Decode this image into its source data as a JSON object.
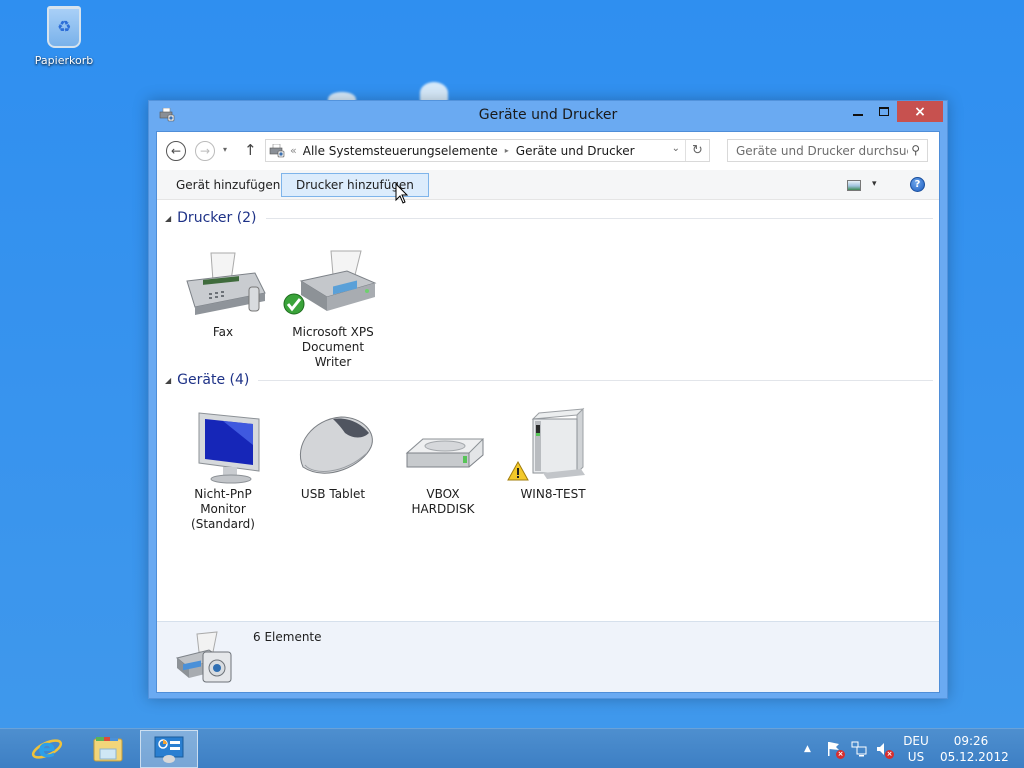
{
  "desktop": {
    "icons": [
      {
        "label": "Papierkorb",
        "icon": "recycle-bin-icon"
      }
    ]
  },
  "window": {
    "title": "Geräte und Drucker",
    "icon": "devices-printers-icon",
    "controls": {
      "minimize": "minimize",
      "maximize": "maximize",
      "close": "×"
    },
    "navigation": {
      "back": "←",
      "forward": "→",
      "recent": "▾",
      "up": "↑",
      "address": {
        "overflow": "«",
        "segments": [
          "Alle Systemsteuerungselemente",
          "Geräte und Drucker"
        ],
        "separator": "▸",
        "dropdown": "⌄",
        "refresh": "↻"
      },
      "search": {
        "placeholder": "Geräte und Drucker durchsuc...",
        "value": "",
        "icon": "⚲"
      }
    },
    "commandbar": {
      "add_device": "Gerät hinzufügen",
      "add_printer": "Drucker hinzufügen",
      "view_dropdown": "▾",
      "help": "?"
    },
    "groups": [
      {
        "title": "Drucker (2)",
        "expanded": true,
        "items": [
          {
            "label": "Fax",
            "icon": "fax-icon",
            "status": null
          },
          {
            "label": "Microsoft XPS Document Writer",
            "icon": "printer-icon",
            "status": "default"
          }
        ]
      },
      {
        "title": "Geräte (4)",
        "expanded": true,
        "items": [
          {
            "label": "Nicht-PnP Monitor (Standard)",
            "icon": "monitor-icon",
            "status": null
          },
          {
            "label": "USB Tablet",
            "icon": "mouse-icon",
            "status": null
          },
          {
            "label": "VBOX HARDDISK",
            "icon": "harddisk-icon",
            "status": null
          },
          {
            "label": "WIN8-TEST",
            "icon": "computer-icon",
            "status": "warning"
          }
        ]
      }
    ],
    "details": {
      "count_text": "6 Elemente"
    }
  },
  "taskbar": {
    "pinned": [
      {
        "name": "Internet Explorer",
        "icon": "internet-explorer-icon",
        "active": false
      },
      {
        "name": "Explorer",
        "icon": "file-explorer-icon",
        "active": false
      },
      {
        "name": "Systemsteuerung",
        "icon": "control-panel-icon",
        "active": true
      }
    ],
    "tray": {
      "show_hidden": "▲",
      "icons": [
        "action-center-icon",
        "network-icon",
        "volume-muted-icon"
      ],
      "language": {
        "line1": "DEU",
        "line2": "US"
      },
      "time": "09:26",
      "date": "05.12.2012"
    }
  },
  "colors": {
    "desktop": "#3793ee",
    "window_frame": "#6aaaf2",
    "close_button": "#c7514f",
    "group_title": "#1e3287",
    "selected_button": "#dcecfc"
  }
}
